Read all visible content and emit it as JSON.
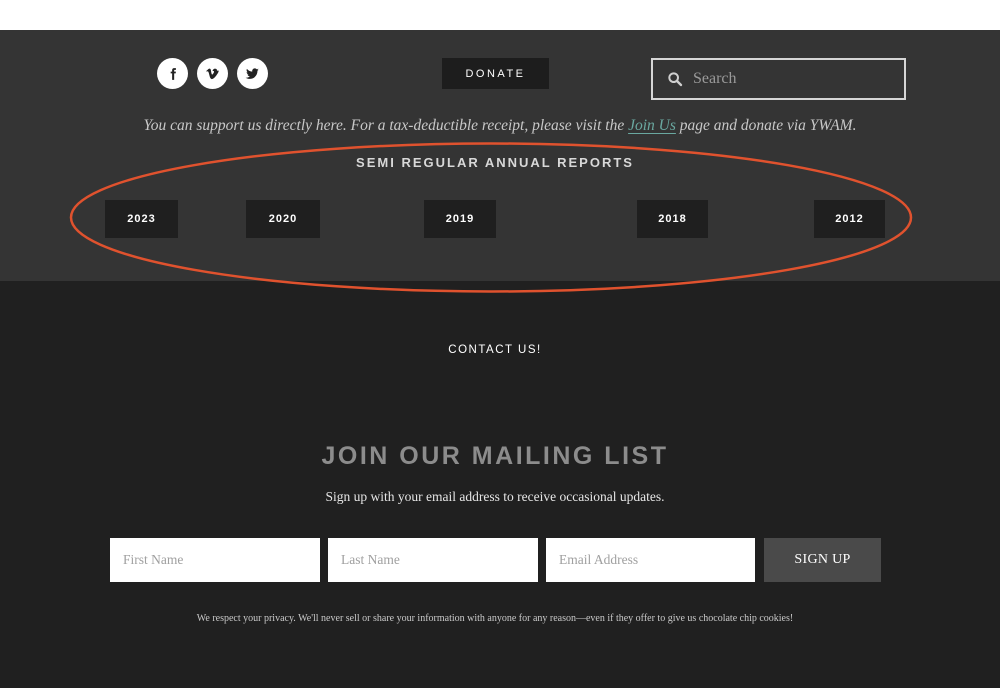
{
  "social": {
    "icons": [
      "facebook-icon",
      "vimeo-icon",
      "twitter-icon"
    ]
  },
  "donate": {
    "label": "DONATE"
  },
  "search": {
    "placeholder": "Search"
  },
  "support": {
    "text_before": "You can support us directly here. For a tax-deductible receipt, please visit the ",
    "link": "Join Us",
    "text_after": " page and donate via YWAM."
  },
  "reports": {
    "title": "SEMI REGULAR ANNUAL REPORTS",
    "years": [
      "2023",
      "2020",
      "2019",
      "2018",
      "2012"
    ]
  },
  "contact": {
    "label": "CONTACT US!"
  },
  "mailing": {
    "title": "JOIN OUR MAILING LIST",
    "subtitle": "Sign up with your email address to receive occasional updates.",
    "first_name_placeholder": "First Name",
    "last_name_placeholder": "Last Name",
    "email_placeholder": "Email Address",
    "signup_label": "SIGN UP",
    "privacy": "We respect your privacy. We'll never sell or share your information with anyone for any reason—even if they offer to give us chocolate chip cookies!"
  },
  "colors": {
    "annotation": "#e0522e",
    "link": "#6aa8a0",
    "upper_bg": "#343434",
    "lower_bg": "#202020"
  }
}
